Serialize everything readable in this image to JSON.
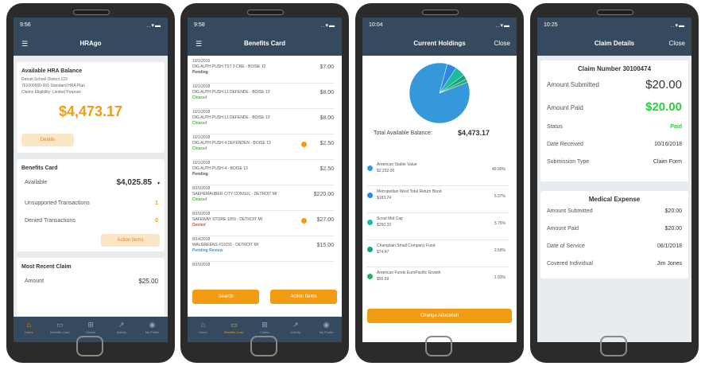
{
  "phone1": {
    "time": "9:56",
    "title": "HRAgo",
    "menu_icon": "hamburger-icon",
    "hra": {
      "heading": "Available HRA Balance",
      "line1": "Detroit School District 123",
      "line2": "761000000-001 Standard HRA Plan",
      "line3": "Claims Eligibility: Limited Purpose",
      "balance": "$4,473.17",
      "details_label": "Details"
    },
    "benefits": {
      "heading": "Benefits Card",
      "available_label": "Available",
      "available_value": "$4,025.85",
      "unsupported_label": "Unsupported Transactions",
      "unsupported_count": "1",
      "denied_label": "Denied Transactions",
      "denied_count": "0",
      "action_label": "Action Items"
    },
    "recent": {
      "heading": "Most Recent Claim",
      "amount_label": "Amount",
      "amount_value": "$25.00"
    }
  },
  "tabs": [
    {
      "label": "Home",
      "icon": "home-icon"
    },
    {
      "label": "Benefits Card",
      "icon": "card-icon"
    },
    {
      "label": "Claims",
      "icon": "claims-icon"
    },
    {
      "label": "Activity",
      "icon": "activity-icon"
    },
    {
      "label": "My Profile",
      "icon": "profile-icon"
    }
  ],
  "phone2": {
    "time": "9:58",
    "title": "Benefits Card",
    "transactions": [
      {
        "date": "10/1/2016",
        "desc": "DIG AUTH PUSH TST 9 CRE - BOISE 12",
        "amount": "$7.00",
        "status": "Pending",
        "status_type": "pending"
      },
      {
        "date": "10/1/2018",
        "desc": "DIG AUTH PUSH 11 DEFENDE - BOISE 13",
        "amount": "$8.00",
        "status": "Cleared",
        "status_type": "cleared"
      },
      {
        "date": "10/1/2018",
        "desc": "DIG AUTH PUSH 11 DEFENDE - BOISE 13",
        "amount": "$8.00",
        "status": "Cleared",
        "status_type": "cleared"
      },
      {
        "date": "10/1/2018",
        "desc": "DIG AUTH PUSH 4 DEFENDEN - BOISE 13",
        "amount": "$2.50",
        "status": "Cleared",
        "status_type": "cleared",
        "flag": true
      },
      {
        "date": "10/1/2018",
        "desc": "DIG AUTH PUSH 4 - BOISE 13",
        "amount": "$2.50",
        "status": "Pending",
        "status_type": "pending"
      },
      {
        "date": "8/15/2018",
        "desc": "SAEHEMAUBER CITY CONSUL - DETROIT MI",
        "amount": "$220.00",
        "status": "Cleared",
        "status_type": "cleared"
      },
      {
        "date": "8/15/2018",
        "desc": "SAFEWAY STORE 1059 - DETROIT MI",
        "amount": "$27.00",
        "status": "Denied",
        "status_type": "denied",
        "flag": true
      },
      {
        "date": "8/14/2018",
        "desc": "WALGREENS #10155 - DETROIT MI",
        "amount": "$15.00",
        "status": "Pending Review",
        "status_type": "review"
      },
      {
        "date": "8/15/2018",
        "desc": "",
        "amount": "",
        "status": "",
        "status_type": "pending"
      }
    ],
    "search_label": "Search",
    "action_label": "Action Items"
  },
  "phone3": {
    "time": "10:04",
    "title": "Current Holdings",
    "close_label": "Close",
    "total_label": "Total Available Balance:",
    "total_value": "$4,473.17",
    "holdings": [
      {
        "name": "American Stable Value",
        "value": "$2,232.00",
        "pct": "49.90%",
        "color": "#3498db"
      },
      {
        "name": "Metropolitan West Total Return Bond",
        "value": "$183.74",
        "pct": "5.37%",
        "color": "#2e86de"
      },
      {
        "name": "Scout Mid Cap",
        "value": "$250.33",
        "pct": "5.75%",
        "color": "#1abc9c"
      },
      {
        "name": "Champlain Small Company Fund",
        "value": "$74.47",
        "pct": "2.59%",
        "color": "#16a085"
      },
      {
        "name": "American Funds EuroPacific Growth",
        "value": "$55.59",
        "pct": "1.93%",
        "color": "#27ae60"
      }
    ],
    "pie": [
      {
        "value": 89.2,
        "color": "#3498db"
      },
      {
        "value": 5.37,
        "color": "#2e86de"
      },
      {
        "value": 5.75,
        "color": "#1abc9c"
      },
      {
        "value": 2.59,
        "color": "#16a085"
      },
      {
        "value": 1.93,
        "color": "#27ae60"
      }
    ],
    "change_label": "Change Allocation"
  },
  "phone4": {
    "time": "10:25",
    "title": "Claim Details",
    "close_label": "Close",
    "claim_number_label": "Claim Number",
    "claim_number": "30100474",
    "submitted_label": "Amount Submitted",
    "submitted_value": "$20.00",
    "paid_label": "Amount Paid",
    "paid_value": "$20.00",
    "status_label": "Status",
    "status_value": "Paid",
    "received_label": "Date Received",
    "received_value": "10/16/2018",
    "type_label": "Submission Type",
    "type_value": "Claim Form",
    "medical": {
      "heading": "Medical Expense",
      "submitted_label": "Amount Submitted",
      "submitted_value": "$20.00",
      "paid_label": "Amount Paid",
      "paid_value": "$20.00",
      "service_label": "Date of Service",
      "service_value": "06/1/2018",
      "individual_label": "Covered Individual",
      "individual_value": "Jim Jones"
    }
  }
}
